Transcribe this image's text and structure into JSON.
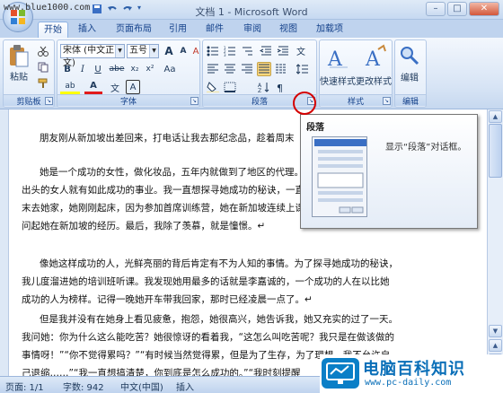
{
  "watermark": "www.blue1000.com",
  "window": {
    "title": "文档 1 - Microsoft Word",
    "minimize": "–",
    "maximize": "□",
    "close": "✕"
  },
  "tabs": [
    "开始",
    "插入",
    "页面布局",
    "引用",
    "邮件",
    "审阅",
    "视图",
    "加载项"
  ],
  "ribbon": {
    "clipboard": {
      "label": "剪贴板",
      "paste": "粘贴"
    },
    "font": {
      "label": "字体",
      "font_name": "宋体 (中文正文)",
      "font_size": "五号",
      "bold": "B",
      "italic": "I",
      "underline": "U",
      "strike": "abe",
      "sub": "x₂",
      "sup": "x²",
      "grow": "A",
      "shrink": "A",
      "clear": "A",
      "aa": "Aa",
      "highlight": "ab",
      "color": "A",
      "wen": "文",
      "border": "A"
    },
    "paragraph": {
      "label": "段落"
    },
    "styles": {
      "label": "样式",
      "quick_styles": "快速样式",
      "change_styles": "更改样式"
    },
    "editing": {
      "label": "编辑",
      "edit": "编辑"
    }
  },
  "tooltip": {
    "title": "段落",
    "description": "显示“段落”对话框。"
  },
  "document": {
    "paragraphs": [
      "      朋友刚从新加坡出差回来，打电话让我去那纪念品，趁着周末",
      "      她是一个成功的女性，做化妆品，五年内就做到了地区的代理。\n出头的女人就有如此成功的事业。我一直想探寻她成功的秘诀，一直\n末去她家，她刚刚起床，因为参加首席训练营，她在新加坡连续上课\n问起她在新加坡的经历。最后，我除了羡慕，就是憧憬。↵",
      "      像她这样成功的人，光鲜亮丽的背后肯定有不为人知的事情。为了探寻她成功的秘诀，\n我儿度溜进她的培训班听课。我发现她用最多的话就是李嘉诚的，一个成功的人在以比她\n成功的人为榜样。记得一晚她开车带我回家，那时已经凌晨一点了。↵",
      "      但是我并没有在她身上看见疲惫，抱怨，她很高兴，她告诉我，她又充实的过了一天。\n我问她：你为什么这么能吃苦？她很惊讶的看着我，“这怎么叫吃苦呢？我只是在做该做的\n事情呀！”“你不觉得累吗？”“有时候当然觉得累，但是为了生存，为了理想，我不允许自\n己退缩……”“我一直想搞清楚，你到底是怎么成功的。”“我时刻提醒"
    ]
  },
  "status": {
    "page": "页面: 1/1",
    "words": "字数: 942",
    "lang": "中文(中国)",
    "mode": "插入"
  },
  "logo": {
    "name": "电脑百科知识",
    "url": "www.pc-daily.com"
  }
}
